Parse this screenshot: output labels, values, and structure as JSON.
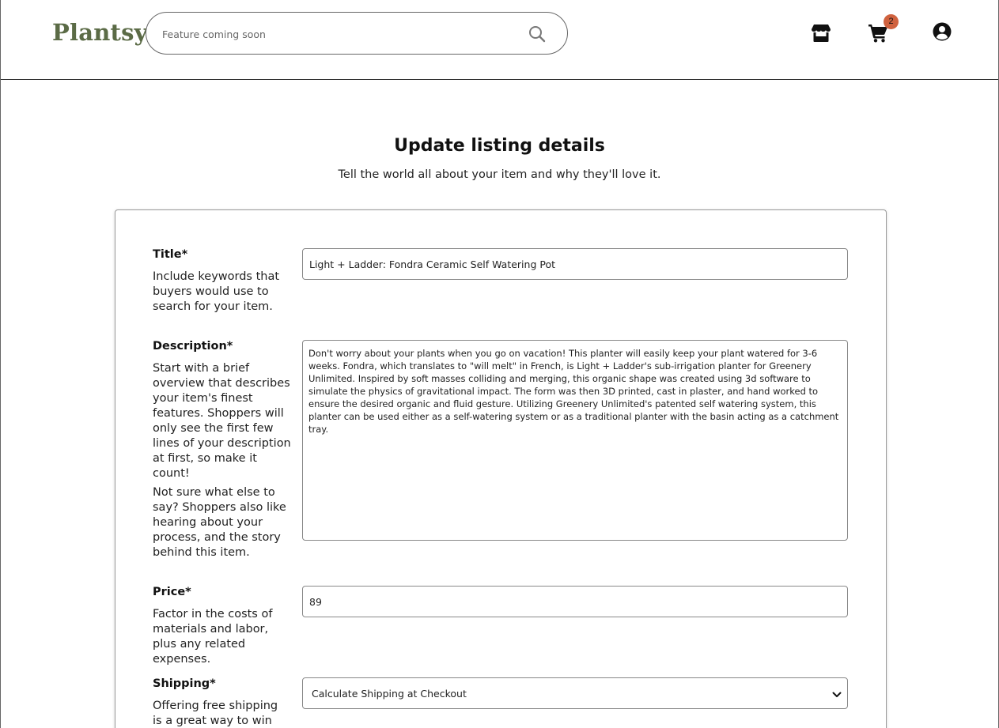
{
  "header": {
    "logo": "Plantsy",
    "search": {
      "placeholder": "Feature coming soon",
      "value": ""
    },
    "icons": [
      "search-icon",
      "shop-icon",
      "cart-icon",
      "user-icon"
    ],
    "cart_count": "2"
  },
  "main": {
    "title": "Update listing details",
    "subtitle": "Tell the world all about your item and why they'll love it."
  },
  "form": {
    "title": {
      "label": "Title*",
      "help": "Include keywords that buyers would use to search for your item.",
      "value": "Light + Ladder: Fondra Ceramic Self Watering Pot"
    },
    "description": {
      "label": "Description*",
      "help": "Start with a brief overview that describes your item's finest features. Shoppers will only see the first few lines of your description at first, so make it count!",
      "help2": "Not sure what else to say? Shoppers also like hearing about your process, and the story behind this item.",
      "value": "Don't worry about your plants when you go on vacation! This planter will easily keep your plant watered for 3-6 weeks. Fondra, which translates to \"will melt\" in French, is Light + Ladder's sub-irrigation planter for Greenery Unlimited. Inspired by soft masses colliding and merging, this organic shape was created using 3d software to simulate the physics of gravitational impact. The form was then 3D printed, cast in plaster, and hand worked to ensure the desired organic and fluid gesture. Utilizing Greenery Unlimited's patented self watering system, this planter can be used either as a self-watering system or as a traditional planter with the basin acting as a catchment tray."
    },
    "price": {
      "label": "Price*",
      "help": "Factor in the costs of materials and labor, plus any related expenses.",
      "value": "89"
    },
    "shipping": {
      "label": "Shipping*",
      "help": "Offering free shipping is a great way to win over",
      "value": "Calculate Shipping at Checkout"
    }
  },
  "colors": {
    "logo": "#5b6b46",
    "badge": "#d0623f",
    "border": "#888888"
  }
}
